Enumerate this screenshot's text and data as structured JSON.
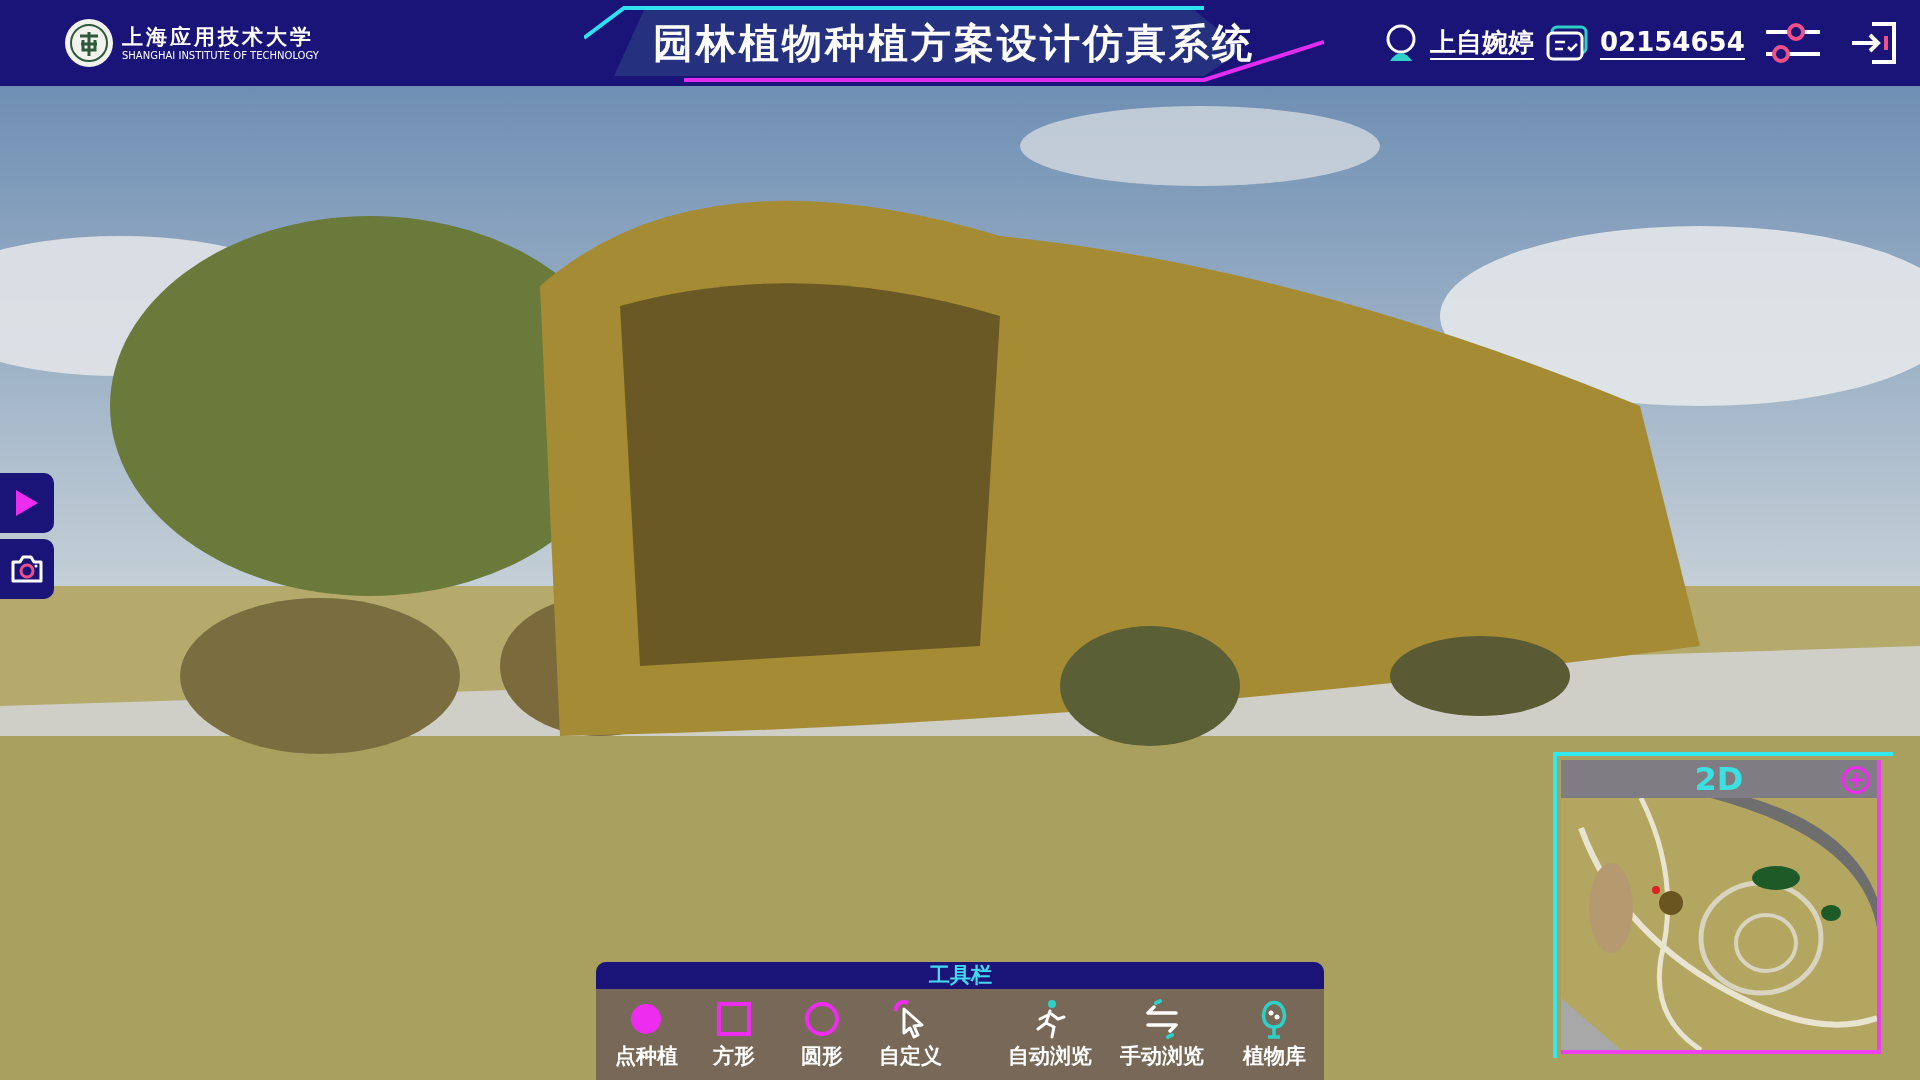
{
  "header": {
    "school_name": "上海应用技术大学",
    "school_name_en": "SHANGHAI INSTITUTE OF TECHNOLOGY",
    "title": "园林植物种植方案设计仿真系统",
    "user_name": "上自婉婷",
    "student_id": "02154654"
  },
  "minimap": {
    "label": "2D"
  },
  "toolbar": {
    "title": "工具栏",
    "draw_tools": [
      {
        "label": "点种植",
        "kind": "dot"
      },
      {
        "label": "方形",
        "kind": "square"
      },
      {
        "label": "圆形",
        "kind": "circle"
      },
      {
        "label": "自定义",
        "kind": "custom"
      }
    ],
    "view_tools": [
      {
        "label": "自动浏览",
        "kind": "walk"
      },
      {
        "label": "手动浏览",
        "kind": "swap"
      },
      {
        "label": "植物库",
        "kind": "tree"
      }
    ]
  }
}
